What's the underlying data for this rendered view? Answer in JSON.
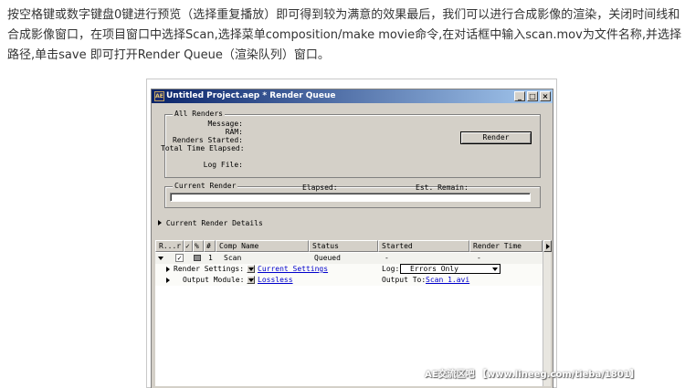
{
  "intro": {
    "text": "按空格键或数字键盘0键进行预览（选择重复播放）即可得到较为满意的效果最后，我们可以进行合成影像的渲染，关闭时间线和合成影像窗口，在项目窗口中选择Scan,选择菜单composition/make movie命令,在对话框中输入scan.mov为文件名称,并选择路径,单击save 即可打开Render Queue（渲染队列）窗口。"
  },
  "window": {
    "title": "Untitled Project.aep * Render Queue",
    "icon": "after-effects-icon",
    "buttons": {
      "minimize": "_",
      "maximize": "□",
      "close": "×"
    }
  },
  "all_renders": {
    "group_label": "All Renders",
    "message_label": "Message:",
    "ram_label": "RAM:",
    "renders_started_label": "Renders Started:",
    "total_time_label": "Total Time Elapsed:",
    "log_file_label": "Log File:",
    "render_button": "Render"
  },
  "current_render": {
    "group_label": "Current Render",
    "elapsed_label": "Elapsed:",
    "est_remain_label": "Est. Remain:"
  },
  "details": {
    "label": "Current Render Details"
  },
  "table": {
    "headers": [
      "R...r",
      "✓",
      "%",
      "#",
      "Comp Name",
      "Status",
      "Started",
      "Render Time"
    ],
    "item": {
      "checked": "✓",
      "index": "1",
      "comp_name": "Scan",
      "status": "Queued",
      "started": "-",
      "render_time": "-"
    },
    "render_settings": {
      "label": "Render Settings:",
      "value": "Current Settings",
      "log_label": "Log:",
      "log_value": "Errors Only"
    },
    "output_module": {
      "label": "Output Module:",
      "value": "Lossless",
      "output_to_label": "Output To:",
      "output_to_value": "Scan_1.avi"
    }
  },
  "watermark": {
    "text": "AE交流区吧 【www.lineeg.com/tieba/1801】"
  }
}
